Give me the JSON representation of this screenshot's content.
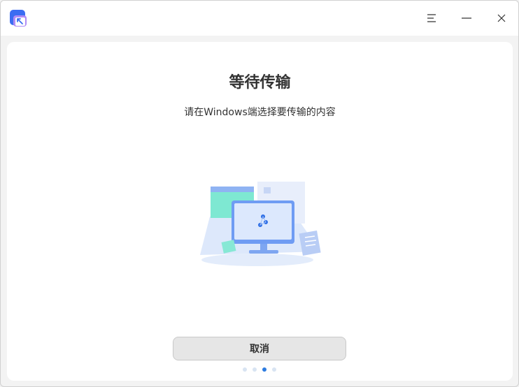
{
  "window": {
    "app_icon": "app-logo-icon",
    "controls": [
      "menu-icon",
      "minimize-icon",
      "close-icon"
    ]
  },
  "main": {
    "title": "等待传输",
    "subtitle": "请在Windows端选择要传输的内容",
    "cancel_label": "取消"
  },
  "pagination": {
    "total": 4,
    "active_index": 2
  },
  "colors": {
    "accent": "#2d7be0",
    "background": "#f3f3f3"
  }
}
